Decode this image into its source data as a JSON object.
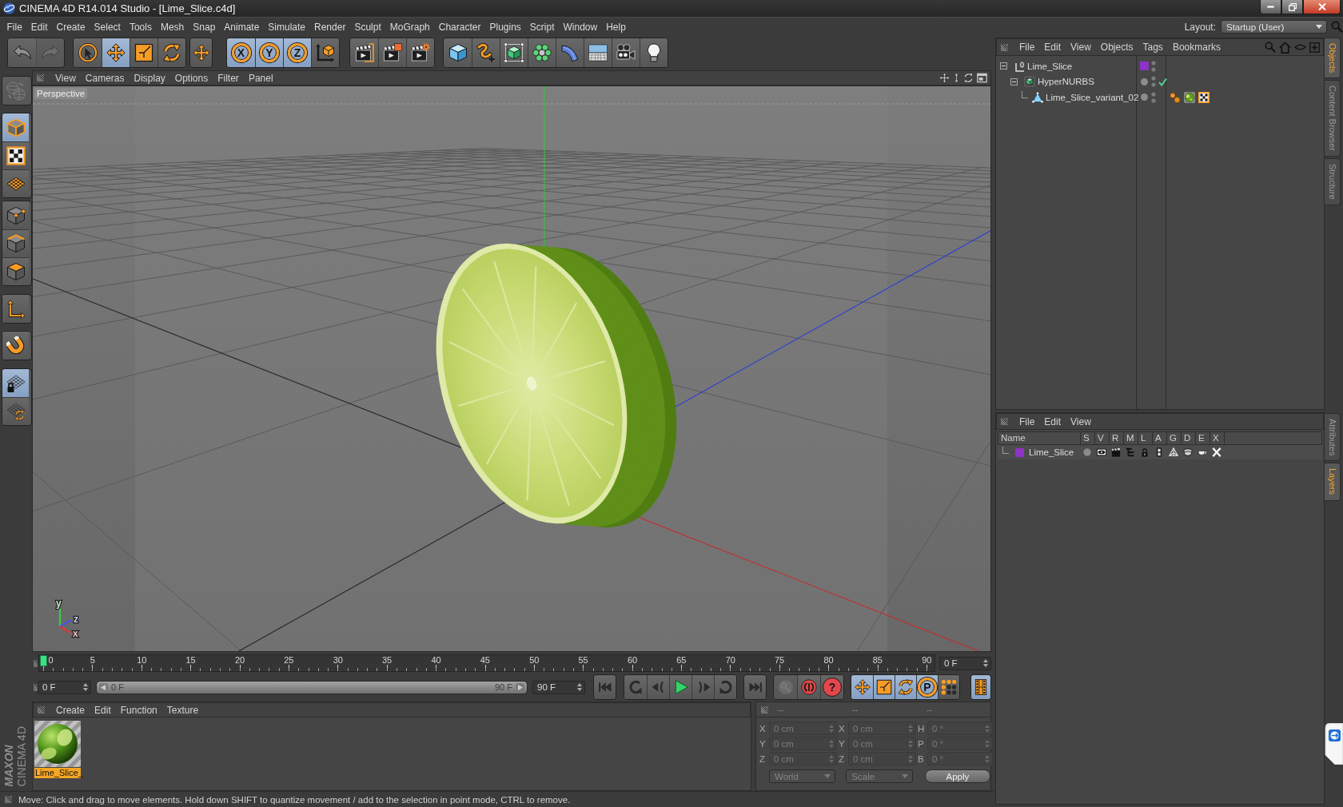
{
  "window": {
    "title": "CINEMA 4D R14.014 Studio - [Lime_Slice.c4d]"
  },
  "menu_bar": [
    "File",
    "Edit",
    "Create",
    "Select",
    "Tools",
    "Mesh",
    "Snap",
    "Animate",
    "Simulate",
    "Render",
    "Sculpt",
    "MoGraph",
    "Character",
    "Plugins",
    "Script",
    "Window",
    "Help"
  ],
  "layout": {
    "label": "Layout:",
    "value": "Startup (User)"
  },
  "toolbar": [
    [
      {
        "kind": "undo",
        "selected": false,
        "disabled": false
      },
      {
        "kind": "redo",
        "selected": false,
        "disabled": true
      }
    ],
    [
      {
        "kind": "select",
        "selected": false,
        "disabled": false
      },
      {
        "kind": "move",
        "selected": true,
        "disabled": false
      },
      {
        "kind": "scale",
        "selected": false,
        "disabled": false
      },
      {
        "kind": "rotate",
        "selected": false,
        "disabled": false
      }
    ],
    [
      {
        "kind": "recent",
        "selected": false,
        "disabled": false
      }
    ],
    [
      {
        "kind": "axislock",
        "label": "X",
        "selected": true,
        "disabled": false
      },
      {
        "kind": "axislock",
        "label": "Y",
        "selected": true,
        "disabled": false
      },
      {
        "kind": "axislock",
        "label": "Z",
        "selected": true,
        "disabled": false
      },
      {
        "kind": "coords",
        "selected": false,
        "disabled": false
      }
    ],
    [
      {
        "kind": "renderview",
        "selected": false,
        "disabled": false
      },
      {
        "kind": "renderpicture",
        "selected": false,
        "disabled": false
      },
      {
        "kind": "rendersettings",
        "selected": false,
        "disabled": false
      }
    ],
    [
      {
        "kind": "cube",
        "selected": false,
        "disabled": false
      },
      {
        "kind": "spline",
        "selected": false,
        "disabled": false
      },
      {
        "kind": "nurbs",
        "selected": false,
        "disabled": false
      },
      {
        "kind": "cloner",
        "selected": false,
        "disabled": false
      },
      {
        "kind": "deformer",
        "selected": false,
        "disabled": false
      },
      {
        "kind": "floor",
        "selected": false,
        "disabled": false
      },
      {
        "kind": "camera",
        "selected": false,
        "disabled": false
      },
      {
        "kind": "light",
        "selected": false,
        "disabled": false
      }
    ]
  ],
  "tools_column": [
    [
      {
        "kind": "convert",
        "selected": false,
        "disabled": true
      }
    ],
    [
      {
        "kind": "model",
        "selected": true,
        "disabled": false
      },
      {
        "kind": "texture",
        "selected": false,
        "disabled": false
      },
      {
        "kind": "workplane",
        "selected": false,
        "disabled": false
      }
    ],
    [
      {
        "kind": "points",
        "selected": false,
        "disabled": false
      },
      {
        "kind": "edges",
        "selected": false,
        "disabled": false
      },
      {
        "kind": "polygons",
        "selected": false,
        "disabled": false
      }
    ],
    [
      {
        "kind": "axis",
        "selected": false,
        "disabled": false
      }
    ],
    [
      {
        "kind": "snap",
        "selected": false,
        "disabled": false
      }
    ],
    [
      {
        "kind": "planelock",
        "selected": true,
        "disabled": false
      },
      {
        "kind": "planerotate",
        "selected": false,
        "disabled": false
      }
    ]
  ],
  "logo": {
    "line_1": "MAXON",
    "line_2": "CINEMA 4D"
  },
  "viewport": {
    "menu": [
      "View",
      "Cameras",
      "Display",
      "Options",
      "Filter",
      "Panel"
    ],
    "camera": "Perspective",
    "gizmo": [
      {
        "label": "y",
        "color": "#3cc84a"
      },
      {
        "label": "z",
        "color": "#4656e0"
      },
      {
        "label": "x",
        "color": "#d83a3a"
      }
    ]
  },
  "timeline": {
    "labels": [
      "0",
      "5",
      "10",
      "15",
      "20",
      "25",
      "30",
      "35",
      "40",
      "45",
      "50",
      "55",
      "60",
      "65",
      "70",
      "75",
      "80",
      "85",
      "90"
    ],
    "level": 0,
    "current": "0 F"
  },
  "playback": {
    "start": "0 F",
    "range": {
      "start": "0 F",
      "end": "90 F",
      "level": 1
    },
    "end": "90 F",
    "buttons": [
      [
        {
          "kind": "start",
          "selected": false,
          "disabled": false
        }
      ],
      [
        {
          "kind": "prevkey",
          "selected": false,
          "disabled": false
        },
        {
          "kind": "prevframe",
          "selected": false,
          "disabled": false
        },
        {
          "kind": "play",
          "selected": false,
          "disabled": false
        },
        {
          "kind": "nextframe",
          "selected": false,
          "disabled": false
        },
        {
          "kind": "nextkey",
          "selected": false,
          "disabled": false
        }
      ],
      [
        {
          "kind": "end",
          "selected": false,
          "disabled": false
        }
      ],
      [
        {
          "kind": "record",
          "selected": false,
          "disabled": true
        },
        {
          "kind": "autokey",
          "selected": false,
          "disabled": false
        },
        {
          "kind": "keyselection",
          "label": "?",
          "selected": false,
          "disabled": false
        }
      ],
      [
        {
          "kind": "move",
          "selected": true,
          "disabled": false
        },
        {
          "kind": "scale",
          "selected": true,
          "disabled": false
        },
        {
          "kind": "rotate",
          "selected": true,
          "disabled": false
        },
        {
          "kind": "parameter",
          "label": "P",
          "selected": true,
          "disabled": false
        },
        {
          "kind": "pla",
          "selected": false,
          "disabled": false
        }
      ],
      [
        {
          "kind": "timeline",
          "selected": true,
          "disabled": false
        }
      ]
    ]
  },
  "materials": {
    "menu": [
      "Create",
      "Edit",
      "Function",
      "Texture"
    ],
    "items": [
      {
        "name": "Lime_Slice_",
        "selected": true
      }
    ]
  },
  "coordinates": {
    "headers": [
      "--",
      "--",
      "--"
    ],
    "disabled": true,
    "rows": [
      [
        {
          "label": "X",
          "value": "0 cm"
        },
        {
          "label": "X",
          "value": "0 cm"
        },
        {
          "label": "H",
          "value": "0 °"
        }
      ],
      [
        {
          "label": "Y",
          "value": "0 cm"
        },
        {
          "label": "Y",
          "value": "0 cm"
        },
        {
          "label": "P",
          "value": "0 °"
        }
      ],
      [
        {
          "label": "Z",
          "value": "0 cm"
        },
        {
          "label": "Z",
          "value": "0 cm"
        },
        {
          "label": "B",
          "value": "0 °"
        }
      ]
    ],
    "dropdowns": [
      "World",
      "Scale"
    ],
    "button": "Apply"
  },
  "status_bar": "Move: Click and drag to move elements. Hold down SHIFT to quantize movement / add to the selection in point mode, CTRL to remove.",
  "objects": {
    "menu": [
      "File",
      "Edit",
      "View",
      "Objects",
      "Tags",
      "Bookmarks"
    ],
    "tree": [
      {
        "name": "Lime_Slice",
        "kind": "null",
        "color": "#8d33c8",
        "expanded": true,
        "children": [
          {
            "name": "HyperNURBS",
            "kind": "nurbs",
            "expanded": true,
            "enabled": true,
            "children": [
              {
                "name": "Lime_Slice_variant_02",
                "kind": "polygon",
                "tags": [
                  {
                    "kind": "phong"
                  },
                  {
                    "kind": "material"
                  },
                  {
                    "kind": "uvw"
                  }
                ]
              }
            ]
          }
        ]
      }
    ]
  },
  "layers": {
    "menu": [
      "File",
      "Edit",
      "View"
    ],
    "columns": [
      "Name",
      "S",
      "V",
      "R",
      "M",
      "L",
      "A",
      "G",
      "D",
      "E",
      "X"
    ],
    "rows": [
      {
        "name": "Lime_Slice",
        "color": "#8d33c8",
        "flags": [
          {
            "kind": "solo"
          },
          {
            "kind": "view"
          },
          {
            "kind": "render"
          },
          {
            "kind": "manager"
          },
          {
            "kind": "locked"
          },
          {
            "kind": "animation"
          },
          {
            "kind": "generators"
          },
          {
            "kind": "deformers"
          },
          {
            "kind": "expressions"
          },
          {
            "kind": "xref"
          }
        ]
      }
    ]
  },
  "side_tabs": {
    "top": [
      {
        "label": "Objects",
        "selected": true
      },
      {
        "label": "Content Browser",
        "selected": false
      },
      {
        "label": "Structure",
        "selected": false
      }
    ],
    "bottom": [
      {
        "label": "Attributes",
        "selected": false
      },
      {
        "label": "Layers",
        "selected": true
      }
    ]
  }
}
